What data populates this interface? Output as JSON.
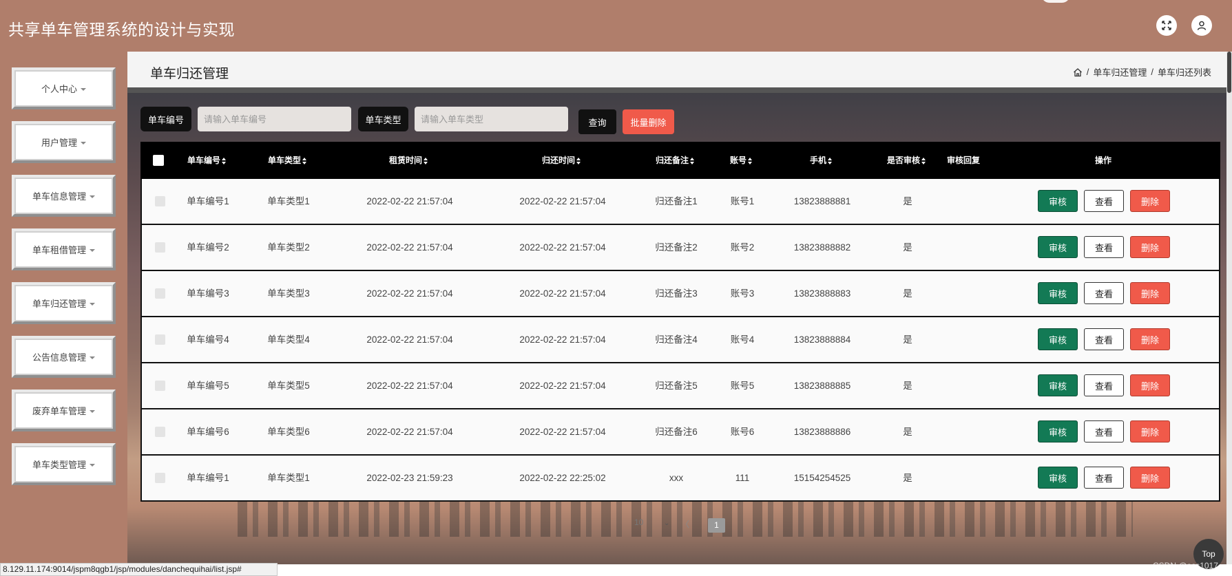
{
  "header": {
    "title": "共享单车管理系统的设计与实现",
    "fullscreen_icon": "fullscreen-icon",
    "user_icon": "user-icon"
  },
  "sidebar": {
    "items": [
      {
        "label": "个人中心"
      },
      {
        "label": "用户管理"
      },
      {
        "label": "单车信息管理"
      },
      {
        "label": "单车租借管理"
      },
      {
        "label": "单车归还管理"
      },
      {
        "label": "公告信息管理"
      },
      {
        "label": "废弃单车管理"
      },
      {
        "label": "单车类型管理"
      }
    ]
  },
  "page": {
    "title": "单车归还管理",
    "breadcrumb": {
      "home_icon": "home-icon",
      "sep": "/",
      "level1": "单车归还管理",
      "level2": "单车归还列表"
    }
  },
  "search": {
    "bike_no_label": "单车编号",
    "bike_no_placeholder": "请输入单车编号",
    "bike_type_label": "单车类型",
    "bike_type_placeholder": "请输入单车类型",
    "query_button": "查询",
    "batch_delete_button": "批量删除"
  },
  "table": {
    "columns": {
      "bike_no": "单车编号",
      "bike_type": "单车类型",
      "rent_time": "租赁时间",
      "return_time": "归还时间",
      "return_note": "归还备注",
      "account": "账号",
      "phone": "手机",
      "audited": "是否审核",
      "audit_reply": "审核回复",
      "actions": "操作"
    },
    "actions": {
      "approve": "审核",
      "view": "查看",
      "delete": "删除"
    },
    "rows": [
      {
        "bike_no": "单车编号1",
        "bike_type": "单车类型1",
        "rent_time": "2022-02-22 21:57:04",
        "return_time": "2022-02-22 21:57:04",
        "return_note": "归还备注1",
        "account": "账号1",
        "phone": "13823888881",
        "audited": "是",
        "audit_reply": ""
      },
      {
        "bike_no": "单车编号2",
        "bike_type": "单车类型2",
        "rent_time": "2022-02-22 21:57:04",
        "return_time": "2022-02-22 21:57:04",
        "return_note": "归还备注2",
        "account": "账号2",
        "phone": "13823888882",
        "audited": "是",
        "audit_reply": ""
      },
      {
        "bike_no": "单车编号3",
        "bike_type": "单车类型3",
        "rent_time": "2022-02-22 21:57:04",
        "return_time": "2022-02-22 21:57:04",
        "return_note": "归还备注3",
        "account": "账号3",
        "phone": "13823888883",
        "audited": "是",
        "audit_reply": ""
      },
      {
        "bike_no": "单车编号4",
        "bike_type": "单车类型4",
        "rent_time": "2022-02-22 21:57:04",
        "return_time": "2022-02-22 21:57:04",
        "return_note": "归还备注4",
        "account": "账号4",
        "phone": "13823888884",
        "audited": "是",
        "audit_reply": ""
      },
      {
        "bike_no": "单车编号5",
        "bike_type": "单车类型5",
        "rent_time": "2022-02-22 21:57:04",
        "return_time": "2022-02-22 21:57:04",
        "return_note": "归还备注5",
        "account": "账号5",
        "phone": "13823888885",
        "audited": "是",
        "audit_reply": ""
      },
      {
        "bike_no": "单车编号6",
        "bike_type": "单车类型6",
        "rent_time": "2022-02-22 21:57:04",
        "return_time": "2022-02-22 21:57:04",
        "return_note": "归还备注6",
        "account": "账号6",
        "phone": "13823888886",
        "audited": "是",
        "audit_reply": ""
      },
      {
        "bike_no": "单车编号1",
        "bike_type": "单车类型1",
        "rent_time": "2022-02-23 21:59:23",
        "return_time": "2022-02-22 22:25:02",
        "return_note": "xxx",
        "account": "111",
        "phone": "15154254525",
        "audited": "是",
        "audit_reply": ""
      }
    ]
  },
  "pagination": {
    "page_size": "10",
    "prev_label": "〈",
    "current_page": "1"
  },
  "top_button": "Top",
  "status_url": "8.129.11.174:9014/jspm8qgb1/jsp/modules/danchequihai/list.jsp#",
  "watermark": "CSDN @ass1017",
  "colors": {
    "header_bg": "#b07e6b",
    "approve": "#137a55",
    "delete": "#f05a4a",
    "table_head": "#000000"
  }
}
